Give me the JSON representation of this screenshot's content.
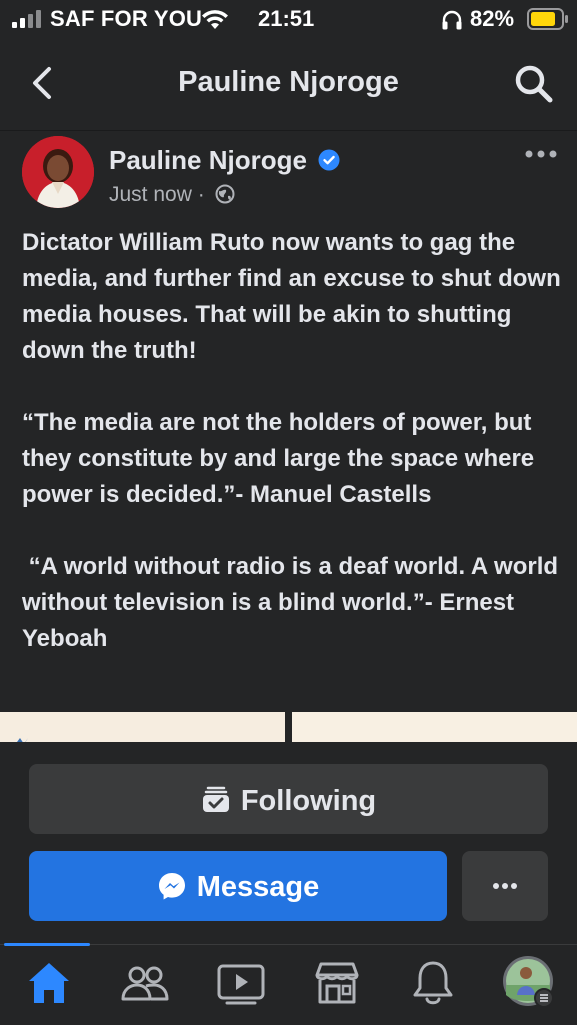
{
  "status_bar": {
    "carrier": "SAF FOR YOU",
    "time": "21:51",
    "battery_percent": "82%",
    "signal_icon": "cellular-signal-icon",
    "wifi_icon": "wifi-icon",
    "headphones_icon": "headphones-icon",
    "battery_icon": "battery-icon",
    "battery_color": "#ffd60a"
  },
  "header": {
    "title": "Pauline Njoroge",
    "back_icon": "chevron-left-icon",
    "search_icon": "search-icon"
  },
  "post": {
    "author": "Pauline Njoroge",
    "verified_icon": "verified-badge-icon",
    "time": "Just now ·",
    "audience_icon": "globe-icon",
    "options_icon": "more-horizontal-icon",
    "text": "Dictator William Ruto now wants to gag the media, and further find an excuse to shut down media houses. That will be akin to shutting down the truth!\n\n“The media are not the holders of power, but they constitute by and large the space where power is decided.”- Manuel Castells\n\n “A world without radio is a deaf world. A world without television is a blind world.”- Ernest Yeboah"
  },
  "actions": {
    "following_label": "Following",
    "following_icon": "following-icon",
    "message_label": "Message",
    "message_icon": "messenger-icon",
    "more_icon": "more-horizontal-icon",
    "accent_color": "#2374e1"
  },
  "tab_bar": {
    "items": [
      {
        "name": "home-icon",
        "active": true
      },
      {
        "name": "friends-icon",
        "active": false
      },
      {
        "name": "video-icon",
        "active": false
      },
      {
        "name": "marketplace-icon",
        "active": false
      },
      {
        "name": "notifications-icon",
        "active": false
      },
      {
        "name": "profile-menu-icon",
        "active": false
      }
    ],
    "active_color": "#2d88ff"
  }
}
